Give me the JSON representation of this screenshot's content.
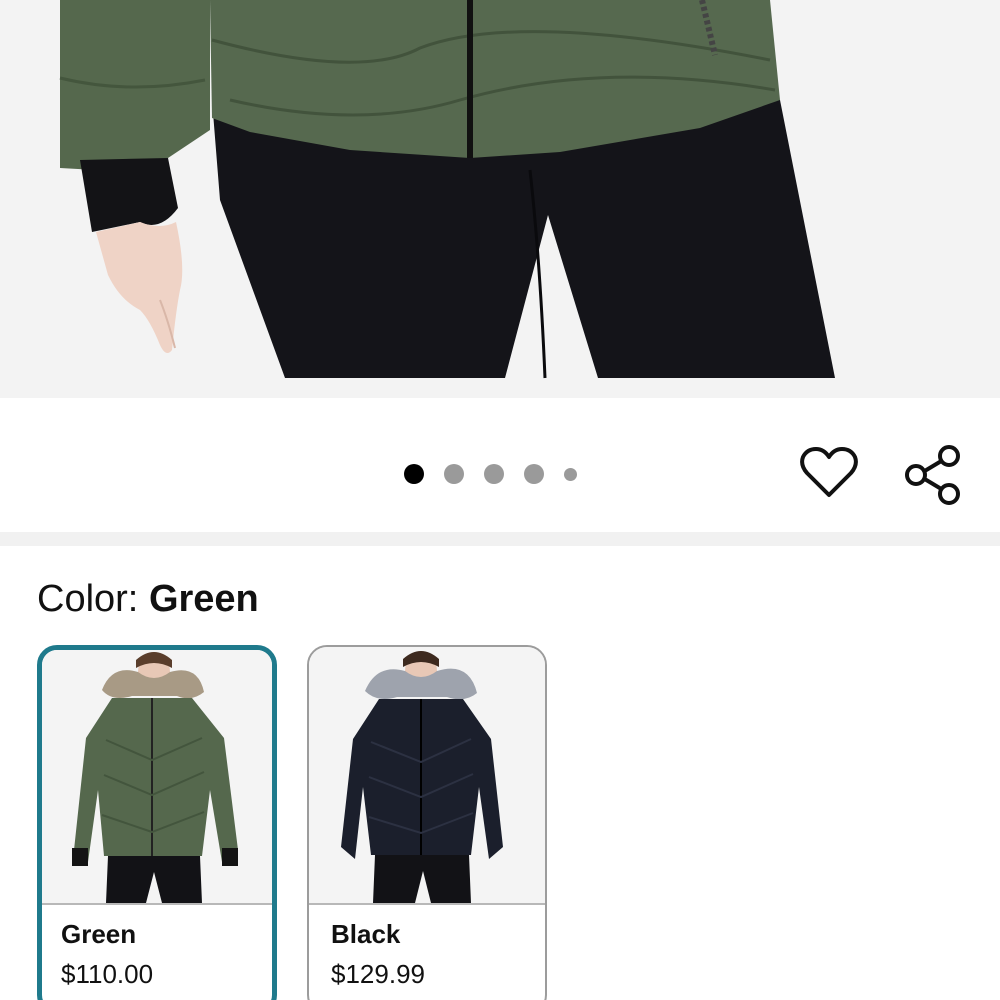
{
  "gallery": {
    "slide_count": 5,
    "active_index": 0
  },
  "actions": {
    "favorite_icon": "heart-outline-icon",
    "share_icon": "share-icon"
  },
  "color_selector": {
    "label": "Color:",
    "selected_value": "Green",
    "accent_color": "#1f7a8c",
    "options": [
      {
        "name": "Green",
        "price": "$110.00",
        "jacket_color": "#55684d",
        "fur_color": "#a89a85",
        "selected": true
      },
      {
        "name": "Black",
        "price": "$129.99",
        "jacket_color": "#1b1f2c",
        "fur_color": "#9ea3ad",
        "selected": false
      }
    ]
  }
}
